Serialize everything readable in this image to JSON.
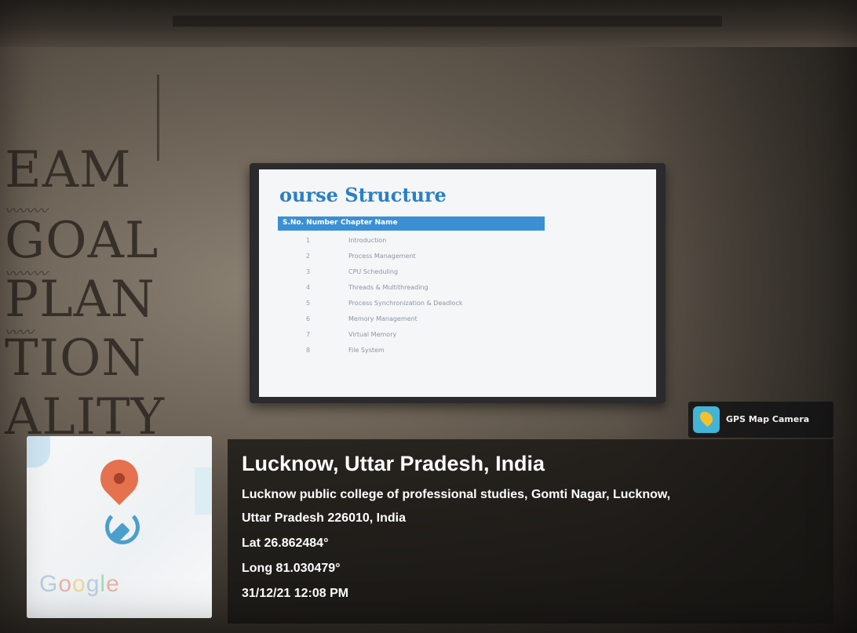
{
  "slide": {
    "title": "ourse Structure",
    "header_no": "S.No. Number",
    "header_name": "Chapter Name",
    "rows": [
      {
        "no": "1",
        "name": "Introduction"
      },
      {
        "no": "2",
        "name": "Process Management"
      },
      {
        "no": "3",
        "name": "CPU Scheduling"
      },
      {
        "no": "4",
        "name": "Threads & Multithreading"
      },
      {
        "no": "5",
        "name": "Process Synchronization & Deadlock"
      },
      {
        "no": "6",
        "name": "Memory Management"
      },
      {
        "no": "7",
        "name": "Virtual Memory"
      },
      {
        "no": "8",
        "name": "File System"
      }
    ]
  },
  "wall_text": [
    "EAM",
    "GOAL",
    "PLAN",
    "TION",
    "ALITY"
  ],
  "gps_badge": {
    "label": "GPS Map Camera",
    "icon": "map-pin-icon"
  },
  "location": {
    "title": "Lucknow, Uttar Pradesh, India",
    "address_line1": "Lucknow public college of professional studies, Gomti Nagar, Lucknow,",
    "address_line2": "Uttar Pradesh 226010, India",
    "lat": "Lat 26.862484°",
    "long": "Long 81.030479°",
    "datetime": "31/12/21 12:08 PM"
  },
  "map": {
    "logo_letters": [
      "G",
      "o",
      "o",
      "g",
      "l",
      "e"
    ]
  },
  "colors": {
    "slide_title": "#2a7fc4",
    "table_header": "#3b8fd4",
    "pin": "#e5714f",
    "overlay": "#161412"
  }
}
